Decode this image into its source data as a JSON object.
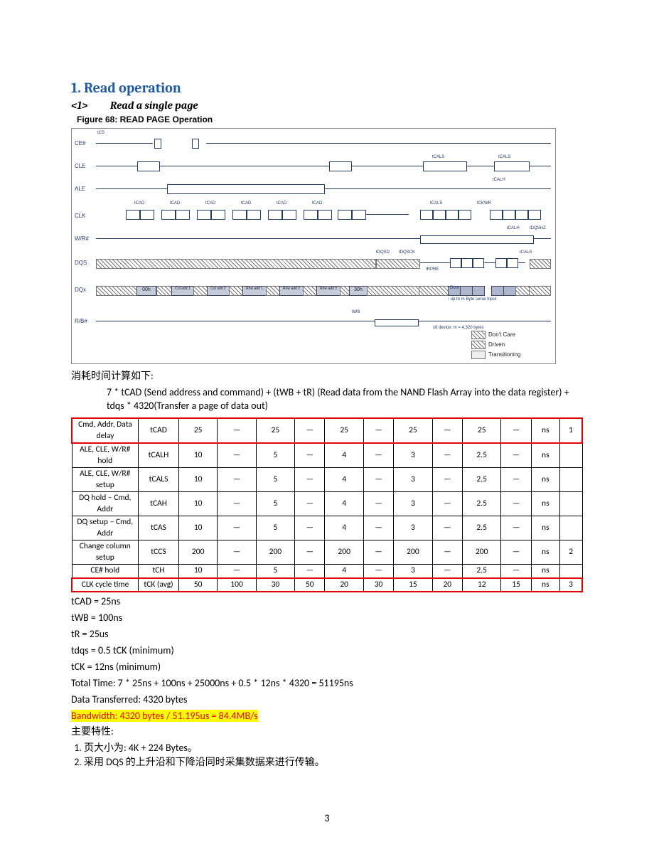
{
  "heading": "1. Read operation",
  "subheading_num": "<1>",
  "subheading_txt": "Read a single page",
  "figure_caption": "Figure 68:   READ PAGE Operation",
  "timing": {
    "signals": [
      "CE#",
      "CLE",
      "ALE",
      "CLK",
      "W/R#",
      "DQS",
      "DQx",
      "R/B#"
    ],
    "top_label": "tCS",
    "tcad": "tCAD",
    "tcals": "tCALS",
    "tcalh": "tCALH",
    "tckwr": "tCKWR",
    "tdqsd": "tDQSD",
    "tdqsck": "tDQSCK",
    "tdqshz": "tDQSHZ",
    "twb": "tWB",
    "trpre": "tRPRE",
    "dq_items": [
      "00h",
      "Col add 1",
      "Col add 2",
      "Row add 1",
      "Row add 2",
      "Row add 3",
      "30h"
    ],
    "dout": "Dout",
    "note1": "↑ up to m Byte serial Input",
    "note2": "x8 device: m = 4,320 bytes",
    "legend": {
      "dc": "Don't Care",
      "dr": "Driven",
      "tr": "Transitioning"
    }
  },
  "text_intro": "消耗时间计算如下:",
  "formula": "7 * tCAD (Send address and command) + (tWB + tR) (Read data from the NAND Flash Array into the data register) + tdqs * 4320(Transfer a page of data out)",
  "tbody": [
    {
      "hl": true,
      "label": "Cmd, Addr, Data delay",
      "sym": "tCAD",
      "c": [
        "25",
        "—",
        "25",
        "—",
        "25",
        "—",
        "25",
        "—",
        "25",
        "—",
        "ns",
        "1"
      ]
    },
    {
      "hl": false,
      "label": "ALE, CLE, W/R# hold",
      "sym": "tCALH",
      "c": [
        "10",
        "—",
        "5",
        "—",
        "4",
        "—",
        "3",
        "—",
        "2.5",
        "—",
        "ns",
        ""
      ]
    },
    {
      "hl": false,
      "label": "ALE, CLE, W/R# setup",
      "sym": "tCALS",
      "c": [
        "10",
        "—",
        "5",
        "—",
        "4",
        "—",
        "3",
        "—",
        "2.5",
        "—",
        "ns",
        ""
      ]
    },
    {
      "hl": false,
      "label": "DQ hold – Cmd, Addr",
      "sym": "tCAH",
      "c": [
        "10",
        "—",
        "5",
        "—",
        "4",
        "—",
        "3",
        "—",
        "2.5",
        "—",
        "ns",
        ""
      ]
    },
    {
      "hl": false,
      "label": "DQ setup – Cmd, Addr",
      "sym": "tCAS",
      "c": [
        "10",
        "—",
        "5",
        "—",
        "4",
        "—",
        "3",
        "—",
        "2.5",
        "—",
        "ns",
        ""
      ]
    },
    {
      "hl": false,
      "label": "Change column setup",
      "sym": "tCCS",
      "c": [
        "200",
        "—",
        "200",
        "—",
        "200",
        "—",
        "200",
        "—",
        "200",
        "—",
        "ns",
        "2"
      ]
    },
    {
      "hl": false,
      "label": "CE# hold",
      "sym": "tCH",
      "c": [
        "10",
        "—",
        "5",
        "—",
        "4",
        "—",
        "3",
        "—",
        "2.5",
        "—",
        "ns",
        ""
      ]
    },
    {
      "hl": true,
      "label": "CLK cycle time",
      "sym": "tCK (avg)",
      "c": [
        "50",
        "100",
        "30",
        "50",
        "20",
        "30",
        "15",
        "20",
        "12",
        "15",
        "ns",
        "3"
      ]
    }
  ],
  "calc": [
    "tCAD = 25ns",
    "tWB = 100ns",
    "tR = 25us",
    "tdqs = 0.5 tCK (minimum)",
    "tCK = 12ns (minimum)",
    "Total Time: 7 * 25ns + 100ns + 25000ns + 0.5 * 12ns * 4320 = 51195ns",
    "Data Transferred: 4320 bytes"
  ],
  "bandwidth": "Bandwidth: 4320 bytes / 51.195us = 84.4MB/s",
  "props_title": "主要特性:",
  "props": [
    "页大小为: 4K + 224 Bytes。",
    "采用 DQS 的上升沿和下降沿同时采集数据来进行传输。"
  ],
  "page_number": "3"
}
